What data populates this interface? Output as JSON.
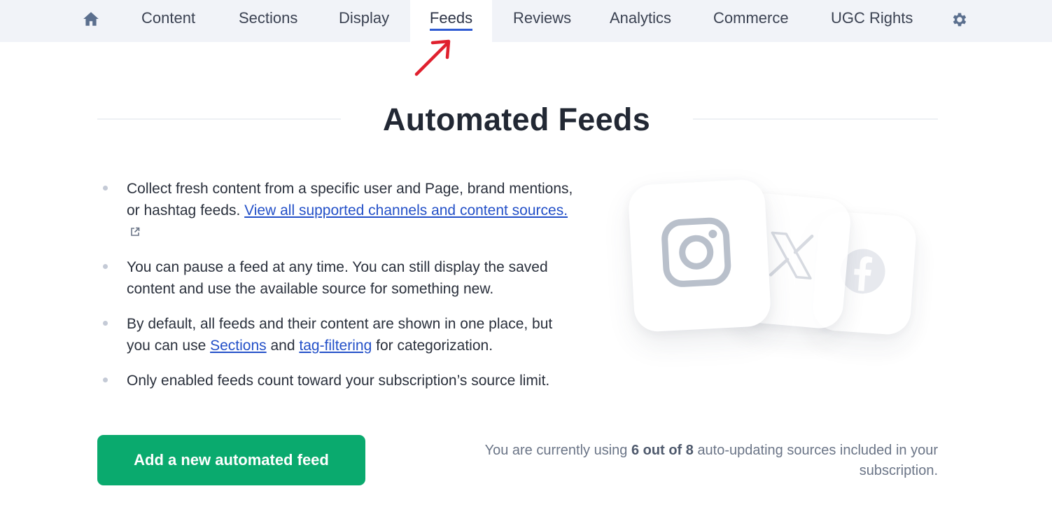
{
  "nav": {
    "home_icon": "home-icon",
    "settings_icon": "gear-icon",
    "tabs": [
      {
        "label": "Content"
      },
      {
        "label": "Sections"
      },
      {
        "label": "Display"
      },
      {
        "label": "Feeds",
        "active": true
      },
      {
        "label": "Reviews"
      },
      {
        "label": "Analytics"
      },
      {
        "label": "Commerce"
      },
      {
        "label": "UGC Rights"
      }
    ],
    "active_underline_color": "#2f5bd3"
  },
  "annotation": {
    "arrow_icon": "red-arrow-icon",
    "color": "#e0202e"
  },
  "page": {
    "title": "Automated Feeds",
    "bullets": {
      "b1_text": "Collect fresh content from a specific user and Page, brand mentions, or hashtag feeds.",
      "b1_link": "View all supported channels and content sources.",
      "b2_text": "You can pause a feed at any time. You can still display the saved content and use the available source for something new.",
      "b3_pre": "By default, all feeds and their content are shown in one place, but you can use",
      "b3_link1": "Sections",
      "b3_mid": "and",
      "b3_link2": "tag-filtering",
      "b3_post": "for categorization.",
      "b4_text": "Only enabled feeds count toward your subscription’s source limit."
    },
    "illustration_icons": [
      "instagram-icon",
      "x-icon",
      "facebook-icon"
    ],
    "cta_label": "Add a new automated feed",
    "cta_color": "#0aaa6e",
    "usage": {
      "pre": "You are currently using",
      "count": "6 out of 8",
      "post": "auto-updating sources included in your subscription."
    }
  }
}
